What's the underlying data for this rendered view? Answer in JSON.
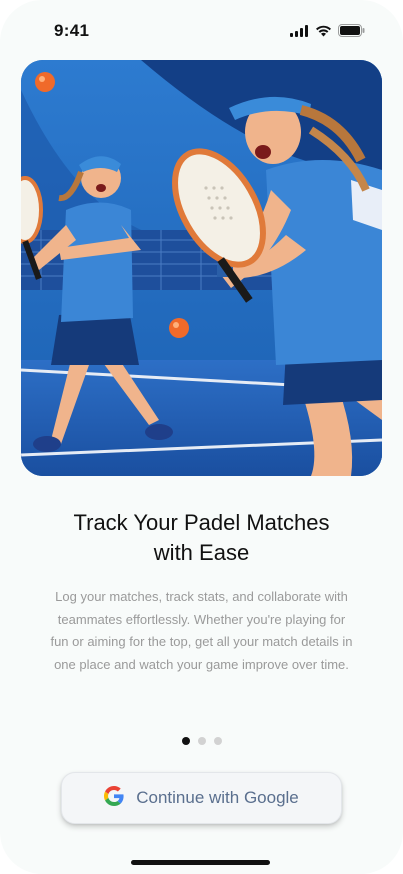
{
  "status_bar": {
    "time": "9:41"
  },
  "hero": {
    "image_description_icon": "padel-players-illustration"
  },
  "onboarding": {
    "title_line1": "Track Your Padel Matches",
    "title_line2": "with Ease",
    "description": "Log your matches, track stats, and collaborate with teammates effortlessly. Whether you're playing for fun or aiming for the top, get all your match details in one place and watch your game improve over time.",
    "page_count": 3,
    "active_page": 1
  },
  "google_button": {
    "label": "Continue with Google",
    "icon": "google-icon"
  },
  "colors": {
    "background": "#f8fbfa",
    "accent_text": "#5a6f8e",
    "active_dot": "#111111",
    "inactive_dot": "#d2d2d2"
  }
}
